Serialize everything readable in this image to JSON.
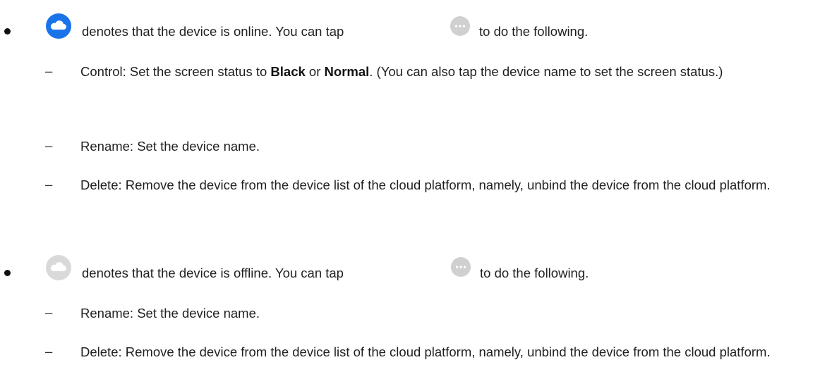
{
  "colors": {
    "online_cloud": "#1a73e8",
    "offline_cloud": "#d9d9d9",
    "more_button": "#d0d0d0"
  },
  "icons": {
    "online": "cloud-online-icon",
    "offline": "cloud-offline-icon",
    "more": "more-ellipsis-icon"
  },
  "online": {
    "text_a": "denotes that the device is online. You can tap",
    "text_b": "to do the following.",
    "control": {
      "p1": "Control: Set the screen status to ",
      "bold1": "Black",
      "p2": " or ",
      "bold2": "Normal",
      "p3": ". (You can also tap the device name to set the screen status.)"
    },
    "rename": "Rename: Set the device name.",
    "delete": "Delete: Remove the device from the device list of the cloud platform, namely, unbind the device from the cloud platform."
  },
  "offline": {
    "text_a": "denotes that the device is offline. You can tap",
    "text_b": "to do the following.",
    "rename": "Rename: Set the device name.",
    "delete": "Delete: Remove the device from the device list of the cloud platform, namely, unbind the device from the cloud platform."
  },
  "dash": "–"
}
